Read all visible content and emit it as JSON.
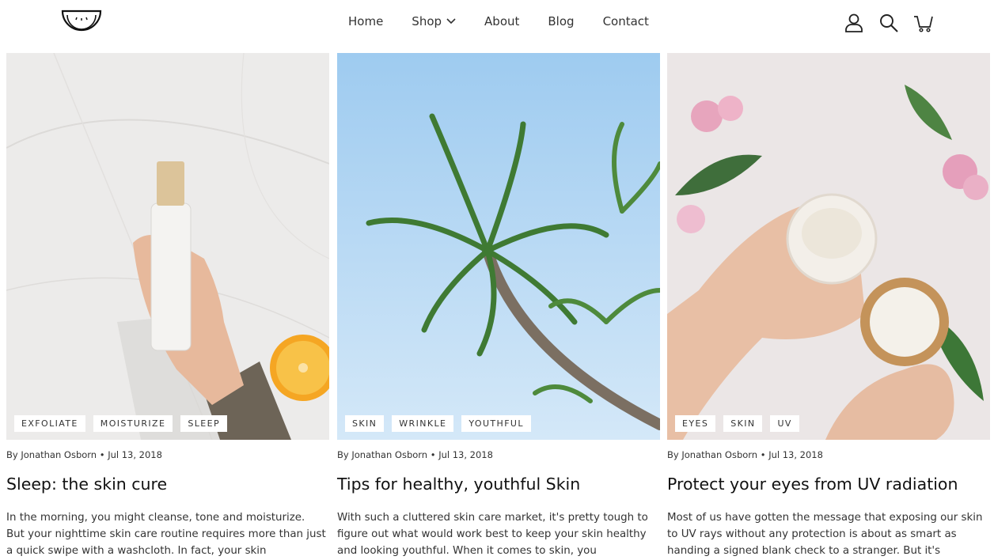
{
  "header": {
    "logo_icon": "watermelon-smile-logo",
    "nav": [
      {
        "label": "Home"
      },
      {
        "label": "Shop",
        "has_dropdown": true
      },
      {
        "label": "About"
      },
      {
        "label": "Blog"
      },
      {
        "label": "Contact"
      }
    ],
    "icons": [
      "account-icon",
      "search-icon",
      "cart-icon"
    ]
  },
  "posts": [
    {
      "tags": [
        "EXFOLIATE",
        "MOISTURIZE",
        "SLEEP"
      ],
      "meta": "By Jonathan Osborn • Jul 13, 2018",
      "title": "Sleep: the skin cure",
      "excerpt": " In the morning, you might cleanse, tone and moisturize. But your nighttime skin care routine requires more than just a quick swipe with a washcloth. In fact, your skin"
    },
    {
      "tags": [
        "SKIN",
        "WRINKLE",
        "YOUTHFUL"
      ],
      "meta": "By Jonathan Osborn • Jul 13, 2018",
      "title": "Tips for healthy, youthful Skin",
      "excerpt": "With such a cluttered skin care market, it's pretty tough to figure out what would work best to keep your skin healthy and looking youthful. When it comes to skin, you"
    },
    {
      "tags": [
        "EYES",
        "SKIN",
        "UV"
      ],
      "meta": "By Jonathan Osborn • Jul 13, 2018",
      "title": "Protect your eyes from UV radiation",
      "excerpt": "Most of us have gotten the message that exposing our skin to UV rays without any protection is about as smart as handing a signed blank check to a stranger. But it's"
    }
  ],
  "colors": {
    "text": "#1f1f1f",
    "tag_bg": "#ffffff",
    "sky": "#bcdcf6",
    "marble": "#ecebea"
  }
}
